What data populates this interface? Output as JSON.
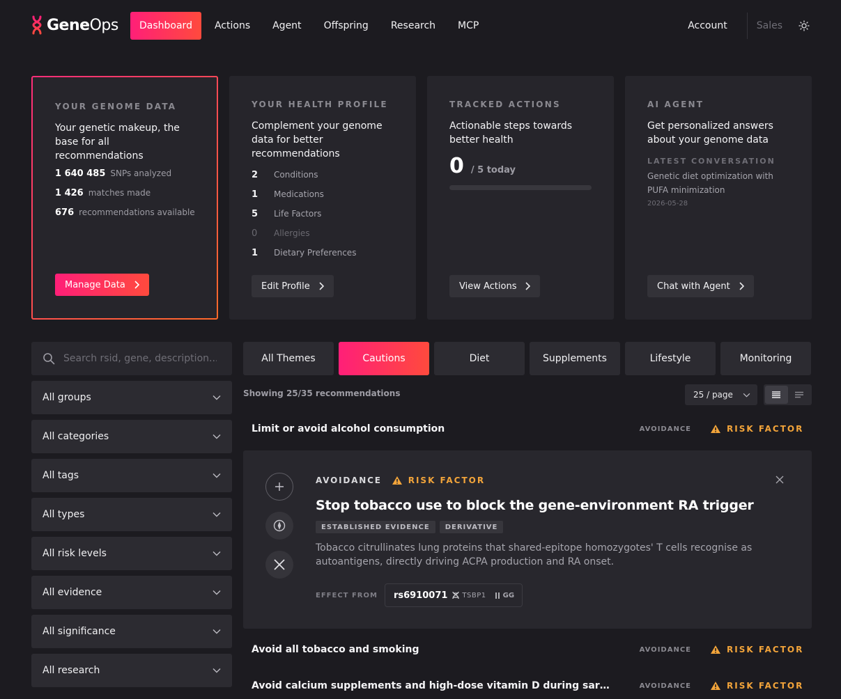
{
  "nav": {
    "brand_bold": "Gene",
    "brand_light": "Ops",
    "links": [
      "Dashboard",
      "Actions",
      "Agent",
      "Offspring",
      "Research",
      "MCP"
    ],
    "account": "Account",
    "sales": "Sales"
  },
  "cards": {
    "genome": {
      "title": "YOUR GENOME DATA",
      "desc": "Your genetic makeup, the base for all recommendations",
      "stats": [
        {
          "num": "1 640 485",
          "label": "SNPs analyzed"
        },
        {
          "num": "1 426",
          "label": "matches made"
        },
        {
          "num": "676",
          "label": "recommendations available"
        }
      ],
      "button": "Manage Data"
    },
    "health": {
      "title": "YOUR HEALTH PROFILE",
      "desc": "Complement your genome data for better recommendations",
      "stats": [
        {
          "num": "2",
          "label": "Conditions"
        },
        {
          "num": "1",
          "label": "Medications"
        },
        {
          "num": "5",
          "label": "Life Factors"
        },
        {
          "num": "0",
          "label": "Allergies"
        },
        {
          "num": "1",
          "label": "Dietary Preferences"
        }
      ],
      "button": "Edit Profile"
    },
    "actions": {
      "title": "TRACKED ACTIONS",
      "desc": "Actionable steps towards better health",
      "count": "0",
      "count_suffix": "/ 5 today",
      "progress": 0,
      "button": "View Actions"
    },
    "agent": {
      "title": "AI AGENT",
      "desc": "Get personalized answers about your genome data",
      "latest_label": "LATEST CONVERSATION",
      "conversation": "Genetic diet optimization with PUFA minimization",
      "date": "2026-05-28",
      "button": "Chat with Agent"
    }
  },
  "search": {
    "placeholder": "Search rsid, gene, description..."
  },
  "filters": [
    "All groups",
    "All categories",
    "All tags",
    "All types",
    "All risk levels",
    "All evidence",
    "All significance",
    "All research"
  ],
  "tabs": {
    "items": [
      "All Themes",
      "Cautions",
      "Diet",
      "Supplements",
      "Lifestyle",
      "Monitoring"
    ],
    "active": "Cautions"
  },
  "list": {
    "showing": "Showing 25/35 recommendations",
    "per_page": "25 / page"
  },
  "recommendations": [
    {
      "title": "Limit or avoid alcohol consumption",
      "kind": "AVOIDANCE",
      "risk": "RISK FACTOR"
    },
    {
      "title": "Avoid all tobacco and smoking",
      "kind": "AVOIDANCE",
      "risk": "RISK FACTOR"
    },
    {
      "title": "Avoid calcium supplements and high-dose vitamin D during sarcoidosis flares",
      "kind": "AVOIDANCE",
      "risk": "RISK FACTOR"
    }
  ],
  "expanded": {
    "kind": "AVOIDANCE",
    "risk": "RISK FACTOR",
    "title": "Stop tobacco use to block the gene-environment RA trigger",
    "tags": [
      "ESTABLISHED EVIDENCE",
      "DERIVATIVE"
    ],
    "description": "Tobacco citrullinates lung proteins that shared-epitope homozygotes' T cells recognise as autoantigens, directly driving ACPA production and RA onset.",
    "effect_label": "EFFECT FROM",
    "rsid": "rs6910071",
    "gene": "TSBP1",
    "genotype": "GG"
  },
  "colors": {
    "accent_start": "#ff1f78",
    "accent_end": "#ff4a3d",
    "risk": "#f2a43a",
    "bg": "#1c1b20",
    "card": "#26252b"
  }
}
